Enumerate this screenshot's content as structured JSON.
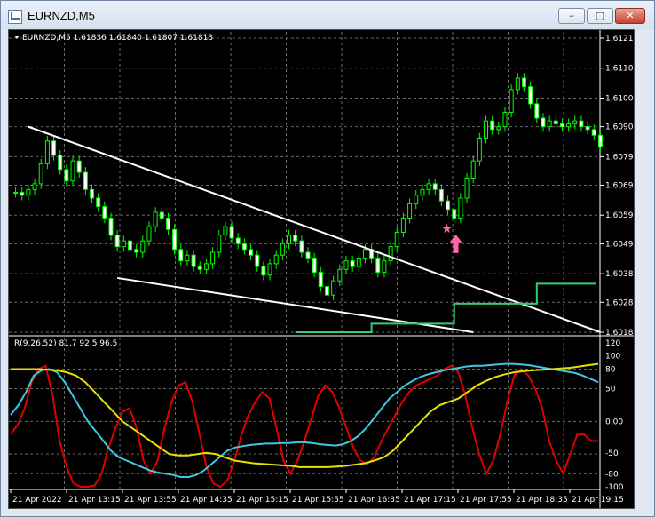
{
  "window": {
    "title": "EURNZD,M5"
  },
  "main_header": "EURNZD,M5  1.61836 1.61840 1.61807 1.61813",
  "sub_header": "R(9,26,52) 81.7 92.5 96.5",
  "price_labels": [
    "1.61210",
    "1.61105",
    "1.61000",
    "1.60900",
    "1.60795",
    "1.60695",
    "1.60590",
    "1.60490",
    "1.60385",
    "1.60285",
    "1.60180"
  ],
  "osc_labels": [
    "120",
    "100",
    "80",
    "50",
    "0.00",
    "-50",
    "-80",
    "-100"
  ],
  "time_labels": [
    "21 Apr 2022",
    "21 Apr 13:15",
    "21 Apr 13:55",
    "21 Apr 14:35",
    "21 Apr 15:15",
    "21 Apr 15:55",
    "21 Apr 16:35",
    "21 Apr 17:15",
    "21 Apr 17:55",
    "21 Apr 18:35",
    "21 Apr 19:15"
  ],
  "colors": {
    "background": "#000000",
    "candle": "#00ff00",
    "trendline": "#ffffff",
    "level": "#33cc77",
    "red": "#e00000",
    "cyan": "#40c8e0",
    "yellow": "#e8e000",
    "marker": "#ff66aa"
  },
  "icons": {
    "min": "minimize-icon",
    "max": "maximize-icon",
    "close": "close-icon",
    "marker": "star-icon",
    "arrow": "up-arrow-icon"
  },
  "chart_data": {
    "type": "candlestick",
    "symbol": "EURNZD",
    "timeframe": "M5",
    "ohlc_current": {
      "open": 1.61836,
      "high": 1.6184,
      "low": 1.61807,
      "close": 1.61813
    },
    "price_axis": [
      1.6121,
      1.61105,
      1.61,
      1.609,
      1.60795,
      1.60695,
      1.6059,
      1.6049,
      1.60385,
      1.60285,
      1.6018
    ],
    "closes": [
      1.6067,
      1.6066,
      1.6068,
      1.607,
      1.6077,
      1.6085,
      1.608,
      1.6075,
      1.6071,
      1.6078,
      1.6074,
      1.6068,
      1.6065,
      1.6062,
      1.6058,
      1.6052,
      1.6048,
      1.605,
      1.6047,
      1.6046,
      1.605,
      1.6055,
      1.606,
      1.6058,
      1.6054,
      1.6047,
      1.6043,
      1.6045,
      1.6041,
      1.604,
      1.6042,
      1.6046,
      1.6052,
      1.6055,
      1.6051,
      1.6049,
      1.6047,
      1.6045,
      1.6041,
      1.6038,
      1.6042,
      1.6045,
      1.6049,
      1.6052,
      1.605,
      1.6046,
      1.6044,
      1.6039,
      1.6034,
      1.6031,
      1.6036,
      1.604,
      1.6043,
      1.6041,
      1.6044,
      1.6047,
      1.6044,
      1.6039,
      1.6043,
      1.6048,
      1.6053,
      1.6058,
      1.6063,
      1.6066,
      1.6068,
      1.607,
      1.6068,
      1.6064,
      1.6061,
      1.6058,
      1.6065,
      1.6072,
      1.6078,
      1.6086,
      1.6092,
      1.6089,
      1.609,
      1.6095,
      1.6103,
      1.6107,
      1.6104,
      1.6098,
      1.6093,
      1.609,
      1.6092,
      1.6091,
      1.609,
      1.6091,
      1.6092,
      1.609,
      1.6089,
      1.6087,
      1.6083
    ],
    "trendlines": [
      {
        "from": [
          2,
          1.609
        ],
        "to": [
          92,
          1.6018
        ]
      },
      {
        "from": [
          16,
          1.6037
        ],
        "to": [
          72,
          1.6018
        ]
      }
    ],
    "level_steps": [
      {
        "start": 44,
        "end": 56,
        "value": 1.6018
      },
      {
        "start": 56,
        "end": 69,
        "value": 1.6021
      },
      {
        "start": 69,
        "end": 82,
        "value": 1.6028
      },
      {
        "start": 82,
        "end": 94,
        "value": 1.6035
      }
    ],
    "marker_index": 68,
    "oscillator": {
      "name": "R(9,26,52)",
      "values": [
        81.7,
        92.5,
        96.5
      ],
      "ylim": [
        -100,
        120
      ],
      "series": [
        {
          "name": "9",
          "values": [
            -20,
            -5,
            20,
            60,
            80,
            85,
            40,
            -30,
            -70,
            -95,
            -100,
            -100,
            -98,
            -80,
            -40,
            -10,
            15,
            20,
            -10,
            -60,
            -80,
            -60,
            -10,
            30,
            55,
            60,
            30,
            -20,
            -70,
            -95,
            -100,
            -90,
            -60,
            -20,
            10,
            30,
            45,
            35,
            -10,
            -60,
            -80,
            -60,
            -30,
            5,
            40,
            55,
            45,
            20,
            -10,
            -40,
            -60,
            -65,
            -55,
            -30,
            -10,
            10,
            30,
            45,
            55,
            60,
            65,
            70,
            80,
            85,
            75,
            40,
            -10,
            -50,
            -80,
            -60,
            -20,
            30,
            70,
            80,
            70,
            50,
            20,
            -30,
            -60,
            -80,
            -50,
            -20,
            -20,
            -30,
            -30
          ]
        },
        {
          "name": "26",
          "values": [
            10,
            25,
            45,
            70,
            78,
            80,
            75,
            60,
            40,
            20,
            0,
            -15,
            -30,
            -45,
            -55,
            -60,
            -65,
            -70,
            -75,
            -78,
            -80,
            -82,
            -85,
            -85,
            -82,
            -75,
            -65,
            -55,
            -45,
            -40,
            -38,
            -36,
            -35,
            -34,
            -34,
            -33,
            -33,
            -32,
            -32,
            -33,
            -35,
            -36,
            -37,
            -35,
            -30,
            -22,
            -10,
            5,
            20,
            35,
            45,
            55,
            62,
            68,
            72,
            75,
            78,
            80,
            82,
            84,
            85,
            85,
            86,
            87,
            88,
            88,
            87,
            86,
            84,
            82,
            80,
            78,
            76,
            74,
            70,
            65,
            60
          ]
        },
        {
          "name": "52",
          "values": [
            80,
            80,
            80,
            80,
            79,
            78,
            75,
            70,
            60,
            45,
            30,
            15,
            0,
            -10,
            -20,
            -30,
            -40,
            -50,
            -52,
            -52,
            -50,
            -48,
            -50,
            -55,
            -60,
            -62,
            -64,
            -65,
            -66,
            -67,
            -68,
            -70,
            -70,
            -70,
            -70,
            -69,
            -68,
            -66,
            -64,
            -60,
            -55,
            -45,
            -30,
            -15,
            0,
            15,
            25,
            30,
            35,
            45,
            55,
            62,
            68,
            72,
            75,
            77,
            78,
            79,
            80,
            81,
            82,
            84,
            86,
            88
          ]
        }
      ]
    }
  }
}
